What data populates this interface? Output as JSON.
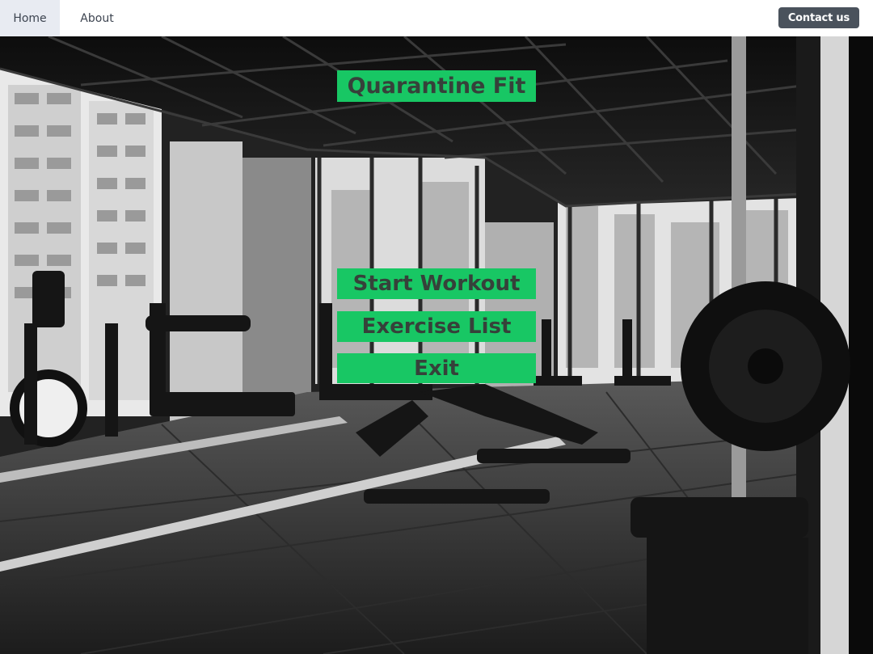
{
  "nav": {
    "home_label": "Home",
    "about_label": "About",
    "contact_label": "Contact us"
  },
  "main": {
    "title": "Quarantine Fit",
    "start_workout_label": "Start Workout",
    "exercise_list_label": "Exercise List",
    "exit_label": "Exit"
  },
  "colors": {
    "accent_green": "#18c764",
    "button_text": "#36413a",
    "nav_bg": "#ffffff",
    "nav_active_bg": "#e8ebf2",
    "contact_bg": "#4a525c"
  }
}
